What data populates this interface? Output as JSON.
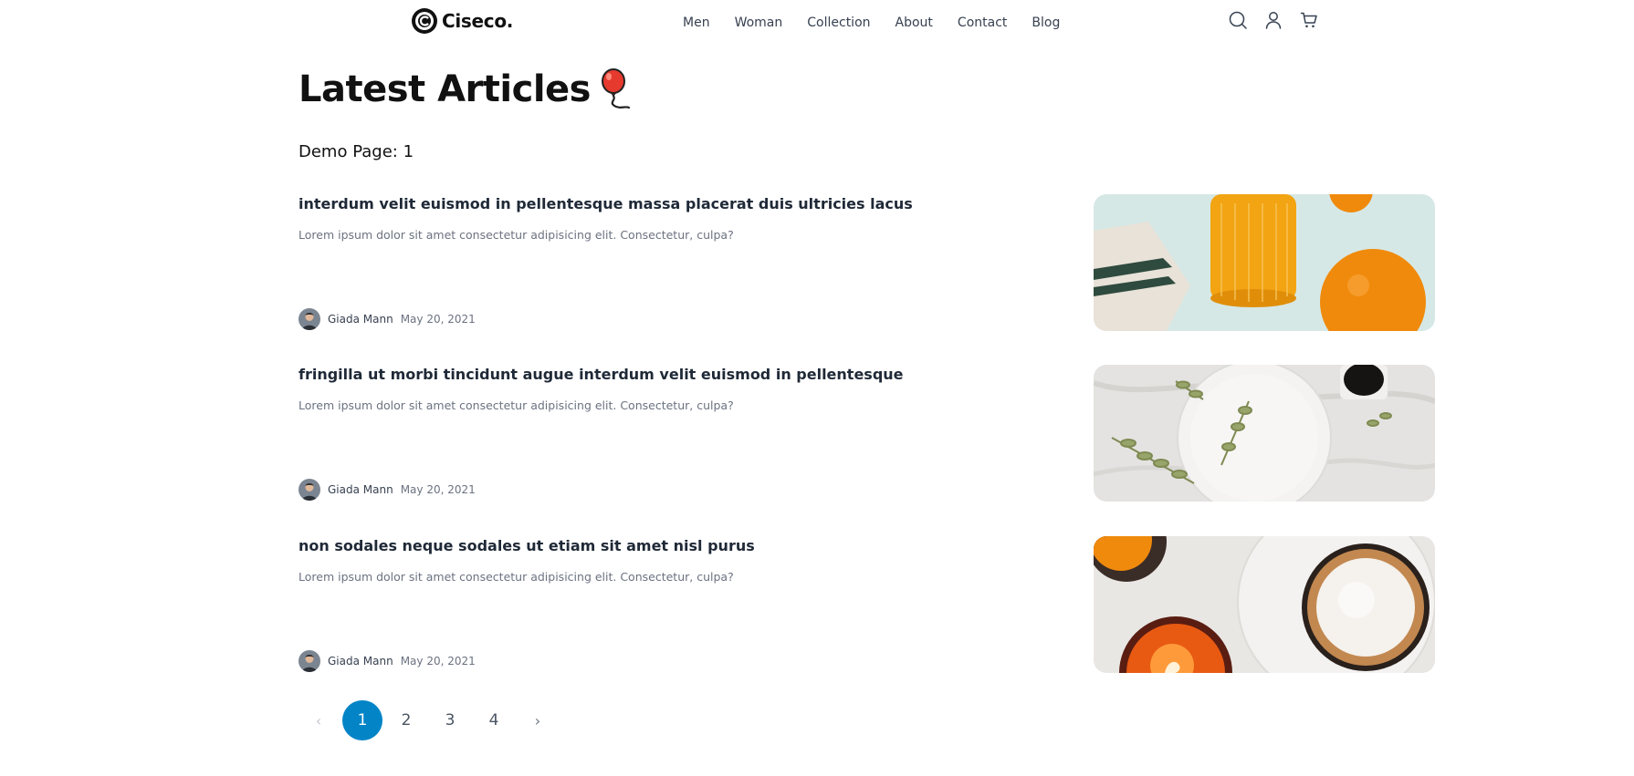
{
  "header": {
    "logo_text": "Ciseco.",
    "nav": [
      "Men",
      "Woman",
      "Collection",
      "About",
      "Contact",
      "Blog"
    ],
    "icons": [
      "search-icon",
      "user-icon",
      "cart-icon"
    ]
  },
  "page": {
    "title": "Latest Articles",
    "title_icon": "balloon-icon",
    "demo_page": "Demo Page: 1"
  },
  "articles": [
    {
      "title": "interdum velit euismod in pellentesque massa placerat duis ultricies lacus",
      "excerpt": "Lorem ipsum dolor sit amet consectetur adipisicing elit. Consectetur, culpa?",
      "author": "Giada Mann",
      "date": "May 20, 2021",
      "image": "orange-juice-photo"
    },
    {
      "title": "fringilla ut morbi tincidunt augue interdum velit euismod in pellentesque",
      "excerpt": "Lorem ipsum dolor sit amet consectetur adipisicing elit. Consectetur, culpa?",
      "author": "Giada Mann",
      "date": "May 20, 2021",
      "image": "white-plate-photo"
    },
    {
      "title": "non sodales neque sodales ut etiam sit amet nisl purus",
      "excerpt": "Lorem ipsum dolor sit amet consectetur adipisicing elit. Consectetur, culpa?",
      "author": "Giada Mann",
      "date": "May 20, 2021",
      "image": "coffee-candle-photo"
    }
  ],
  "pagination": {
    "prev": "‹",
    "pages": [
      "1",
      "2",
      "3",
      "4"
    ],
    "next": "›",
    "current": "1"
  },
  "colors": {
    "accent": "#0284c7",
    "text": "#1f2937",
    "muted": "#6b7280"
  }
}
